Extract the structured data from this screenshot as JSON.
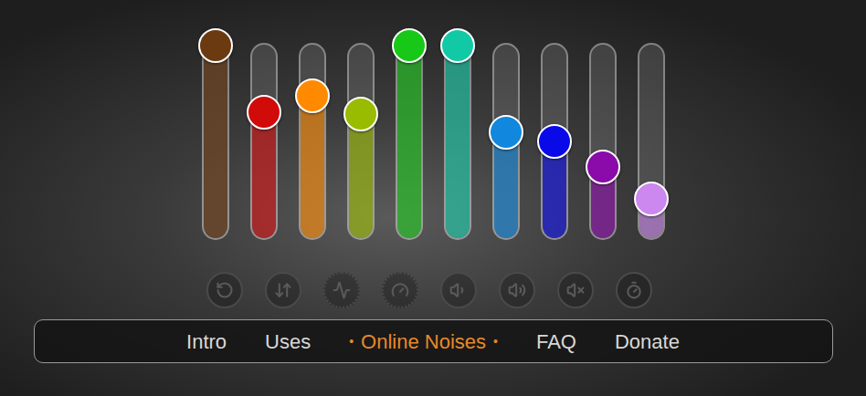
{
  "sliders": [
    {
      "color": "#6b3a10",
      "level": 1.0
    },
    {
      "color": "#d10a0a",
      "level": 0.63
    },
    {
      "color": "#ff8a00",
      "level": 0.72
    },
    {
      "color": "#99bb00",
      "level": 0.62
    },
    {
      "color": "#18c818",
      "level": 1.0
    },
    {
      "color": "#12c9a6",
      "level": 1.0
    },
    {
      "color": "#1188dd",
      "level": 0.52
    },
    {
      "color": "#0a0ae8",
      "level": 0.47
    },
    {
      "color": "#8a0aaa",
      "level": 0.33
    },
    {
      "color": "#cc88ee",
      "level": 0.15
    }
  ],
  "nav": {
    "marker": "•",
    "items": [
      {
        "label": "Intro",
        "selected": false
      },
      {
        "label": "Uses",
        "selected": false
      },
      {
        "label": "Online Noises",
        "selected": true
      },
      {
        "label": "FAQ",
        "selected": false
      },
      {
        "label": "Donate",
        "selected": false
      }
    ]
  }
}
